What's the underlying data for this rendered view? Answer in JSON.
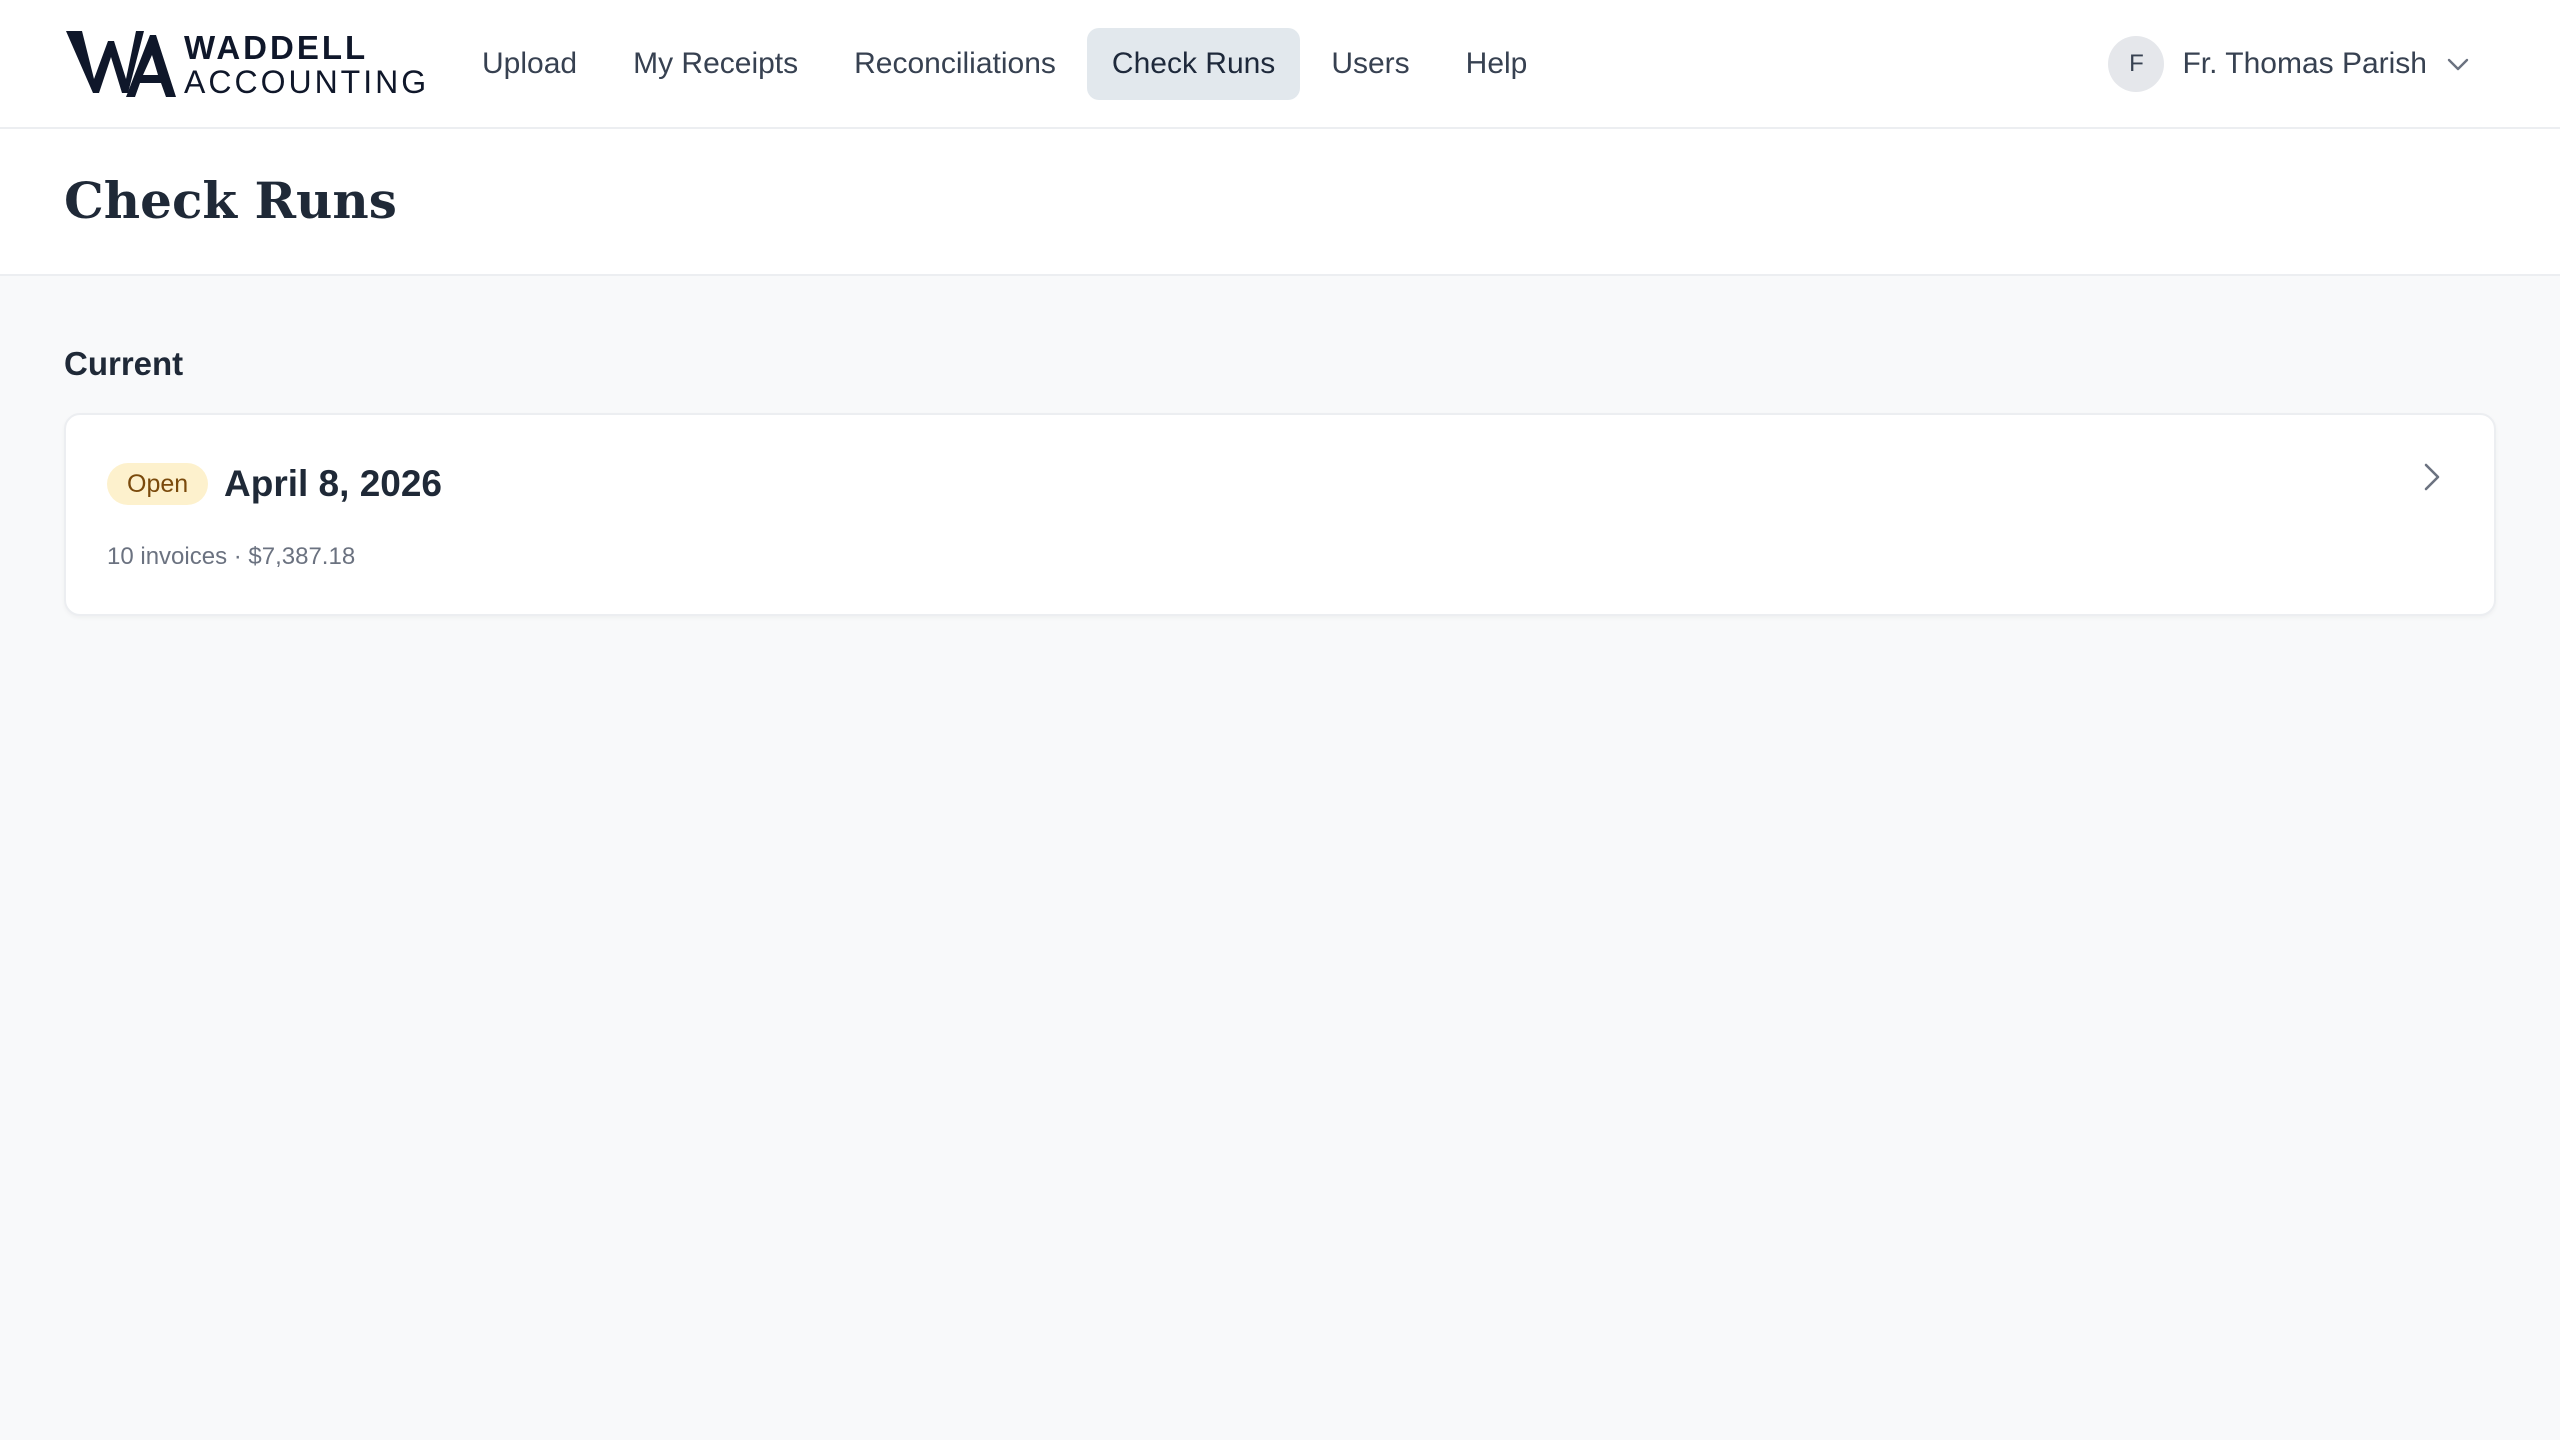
{
  "brand": {
    "line1": "WADDELL",
    "line2": "ACCOUNTING"
  },
  "nav": {
    "items": [
      {
        "label": "Upload"
      },
      {
        "label": "My Receipts"
      },
      {
        "label": "Reconciliations"
      },
      {
        "label": "Check Runs"
      },
      {
        "label": "Users"
      },
      {
        "label": "Help"
      }
    ],
    "active": "Check Runs"
  },
  "user": {
    "initial": "F",
    "name": "Fr. Thomas Parish"
  },
  "page": {
    "title": "Check Runs"
  },
  "section": {
    "title": "Current"
  },
  "runs": [
    {
      "status": "Open",
      "date": "April 8, 2026",
      "meta": "10 invoices · $7,387.18"
    }
  ],
  "colors": {
    "active_nav_bg": "#e2e8ed",
    "open_badge_bg": "#fdf1cd",
    "open_badge_text": "#7a4a0c",
    "page_bg": "#f8f9fa"
  },
  "icons": {
    "user_menu": "chevron-down-icon",
    "run_open": "chevron-right-icon"
  }
}
